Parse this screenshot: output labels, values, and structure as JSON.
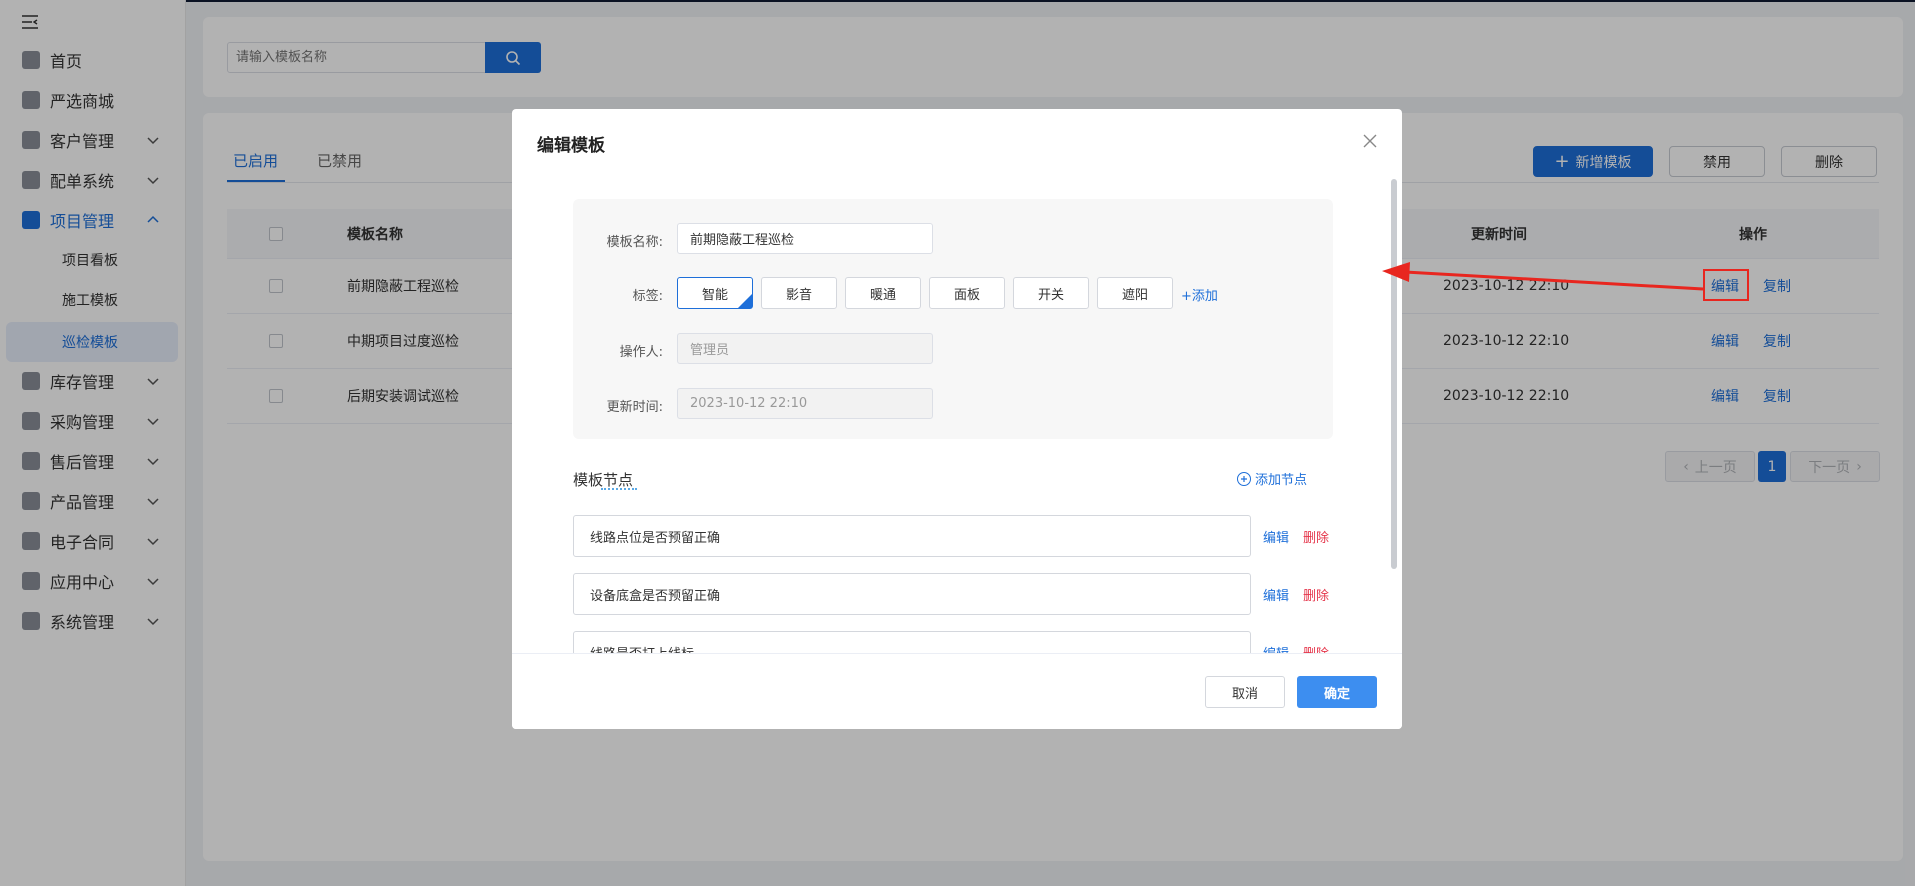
{
  "sidebar": {
    "items": [
      {
        "label": "首页",
        "icon": "home-icon",
        "expand": false
      },
      {
        "label": "严选商城",
        "icon": "shop-icon",
        "expand": false
      },
      {
        "label": "客户管理",
        "icon": "customer-icon",
        "expand": true
      },
      {
        "label": "配单系统",
        "icon": "order-icon",
        "expand": true
      },
      {
        "label": "项目管理",
        "icon": "folder-icon",
        "expand": true,
        "active": true
      },
      {
        "label": "库存管理",
        "icon": "inventory-icon",
        "expand": true
      },
      {
        "label": "采购管理",
        "icon": "cart-icon",
        "expand": true
      },
      {
        "label": "售后管理",
        "icon": "headset-icon",
        "expand": true
      },
      {
        "label": "产品管理",
        "icon": "product-icon",
        "expand": true
      },
      {
        "label": "电子合同",
        "icon": "contract-icon",
        "expand": true
      },
      {
        "label": "应用中心",
        "icon": "apps-icon",
        "expand": true
      },
      {
        "label": "系统管理",
        "icon": "settings-icon",
        "expand": true
      }
    ],
    "sub_items": [
      "项目看板",
      "施工模板",
      "巡检模板"
    ],
    "current_sub": "巡检模板"
  },
  "search": {
    "placeholder": "请输入模板名称"
  },
  "tabs": [
    {
      "label": "已启用"
    },
    {
      "label": "已禁用"
    }
  ],
  "toolbar": {
    "add_label": "新增模板",
    "disable_label": "禁用",
    "delete_label": "删除"
  },
  "table": {
    "headers": {
      "name": "模板名称",
      "updated": "更新时间",
      "ops": "操作"
    },
    "rows": [
      {
        "name": "前期隐蔽工程巡检",
        "updated": "2023-10-12 22:10",
        "edit": "编辑",
        "copy": "复制"
      },
      {
        "name": "中期项目过度巡检",
        "updated": "2023-10-12 22:10",
        "edit": "编辑",
        "copy": "复制"
      },
      {
        "name": "后期安装调试巡检",
        "updated": "2023-10-12 22:10",
        "edit": "编辑",
        "copy": "复制"
      }
    ]
  },
  "pager": {
    "prev": "上一页",
    "current": "1",
    "next": "下一页"
  },
  "modal": {
    "title": "编辑模板",
    "form": {
      "name_label": "模板名称:",
      "name_value": "前期隐蔽工程巡检",
      "tags_label": "标签:",
      "tags": [
        "智能",
        "影音",
        "暖通",
        "面板",
        "开关",
        "遮阳"
      ],
      "selected_tag": "智能",
      "add_tag": "+添加",
      "operator_label": "操作人:",
      "operator_value": "管理员",
      "time_label": "更新时间:",
      "time_value": "2023-10-12 22:10"
    },
    "nodes_title": "模板节点",
    "add_node": "添加节点",
    "nodes": [
      {
        "text": "线路点位是否预留正确",
        "edit": "编辑",
        "del": "删除"
      },
      {
        "text": "设备底盒是否预留正确",
        "edit": "编辑",
        "del": "删除"
      },
      {
        "text": "线路是否打上线标",
        "edit": "编辑",
        "del": "删除"
      }
    ],
    "cancel": "取消",
    "ok": "确定"
  },
  "colors": {
    "primary": "#1e6fd9",
    "danger": "#e5354a",
    "annotation": "#e8261f"
  }
}
